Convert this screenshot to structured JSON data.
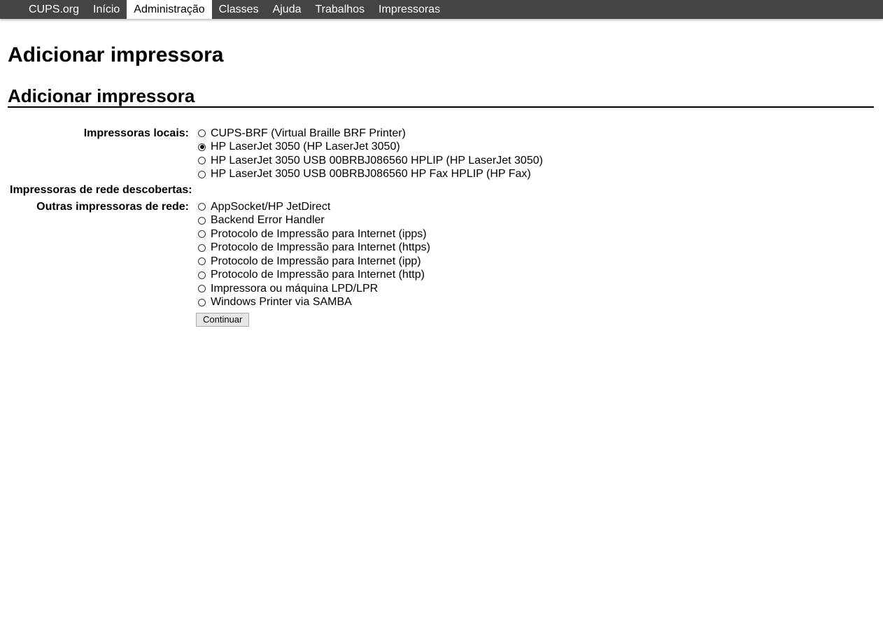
{
  "nav": {
    "items": [
      {
        "label": "CUPS.org",
        "active": false
      },
      {
        "label": "Início",
        "active": false
      },
      {
        "label": "Administração",
        "active": true
      },
      {
        "label": "Classes",
        "active": false
      },
      {
        "label": "Ajuda",
        "active": false
      },
      {
        "label": "Trabalhos",
        "active": false
      },
      {
        "label": "Impressoras",
        "active": false
      }
    ]
  },
  "page": {
    "title": "Adicionar impressora",
    "section_title": "Adicionar impressora"
  },
  "form": {
    "local_label": "Impressoras locais:",
    "local_options": [
      {
        "label": "CUPS-BRF (Virtual Braille BRF Printer)",
        "checked": false
      },
      {
        "label": "HP LaserJet 3050 (HP LaserJet 3050)",
        "checked": true
      },
      {
        "label": "HP LaserJet 3050 USB 00BRBJ086560 HPLIP (HP LaserJet 3050)",
        "checked": false
      },
      {
        "label": "HP LaserJet 3050 USB 00BRBJ086560 HP Fax HPLIP (HP Fax)",
        "checked": false
      }
    ],
    "discovered_label": "Impressoras de rede descobertas:",
    "other_label": "Outras impressoras de rede:",
    "other_options": [
      {
        "label": "AppSocket/HP JetDirect",
        "checked": false
      },
      {
        "label": "Backend Error Handler",
        "checked": false
      },
      {
        "label": "Protocolo de Impressão para Internet (ipps)",
        "checked": false
      },
      {
        "label": "Protocolo de Impressão para Internet (https)",
        "checked": false
      },
      {
        "label": "Protocolo de Impressão para Internet (ipp)",
        "checked": false
      },
      {
        "label": "Protocolo de Impressão para Internet (http)",
        "checked": false
      },
      {
        "label": "Impressora ou máquina LPD/LPR",
        "checked": false
      },
      {
        "label": "Windows Printer via SAMBA",
        "checked": false
      }
    ],
    "submit_label": "Continuar"
  }
}
